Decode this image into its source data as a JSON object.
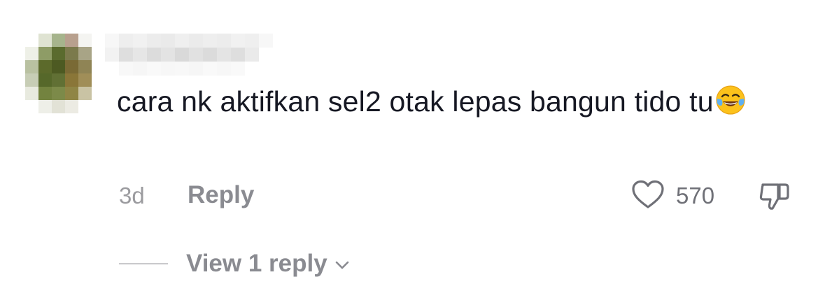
{
  "comment": {
    "text": "cara nk aktifkan sel2 otak lepas bangun tido tu",
    "emoji_name": "face-with-tears-of-joy",
    "timestamp": "3d",
    "reply_label": "Reply",
    "like_count": "570",
    "view_replies_label": "View 1 reply"
  },
  "icons": {
    "like": "heart-outline-icon",
    "dislike": "thumbs-down-outline-icon",
    "expand": "chevron-down-icon"
  },
  "colors": {
    "text_primary": "#161823",
    "text_secondary": "#8a8b91",
    "timestamp": "#9b9b9f",
    "icon": "#6f7077"
  }
}
